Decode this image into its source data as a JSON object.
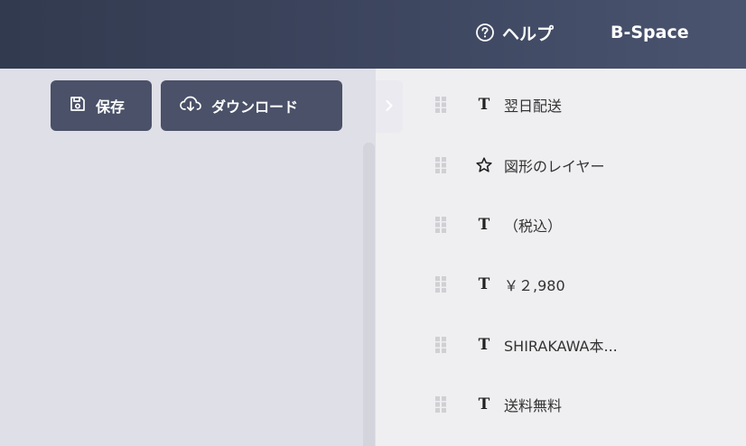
{
  "header": {
    "help_label": "ヘルプ",
    "brand": "B-Space",
    "background_color": "#3a4259"
  },
  "toolbar": {
    "save_label": "保存",
    "save_icon": "save-icon",
    "download_label": "ダウンロード",
    "download_icon": "cloud-download-icon",
    "button_color": "#4a5168"
  },
  "layers": {
    "items": [
      {
        "type": "text",
        "icon": "text-type-icon",
        "label": "翌日配送"
      },
      {
        "type": "shape",
        "icon": "star-icon",
        "label": "図形のレイヤー"
      },
      {
        "type": "text",
        "icon": "text-type-icon",
        "label": "（税込）"
      },
      {
        "type": "text",
        "icon": "text-type-icon",
        "label": "￥２,980"
      },
      {
        "type": "text",
        "icon": "text-type-icon",
        "label": "SHIRAKAWA本..."
      },
      {
        "type": "text",
        "icon": "text-type-icon",
        "label": "送料無料"
      }
    ],
    "type_glyph": "T"
  }
}
